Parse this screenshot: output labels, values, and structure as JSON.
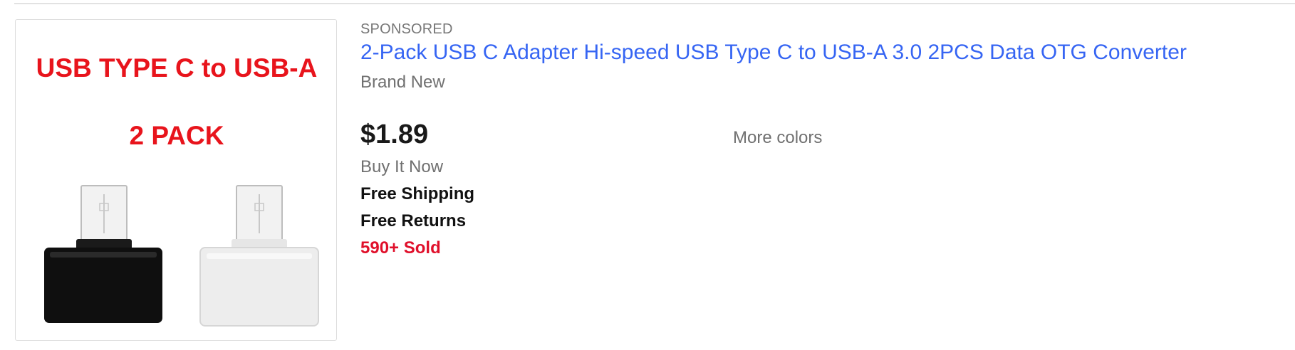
{
  "listing": {
    "badge": "SPONSORED",
    "title": "2-Pack USB C Adapter Hi-speed USB Type C to USB-A 3.0 2PCS Data OTG Converter",
    "condition": "Brand New",
    "price": "$1.89",
    "buy_format": "Buy It Now",
    "shipping": "Free Shipping",
    "returns": "Free Returns",
    "sold": "590+ Sold",
    "more_colors": "More colors",
    "image": {
      "line1": "USB TYPE C to USB-A",
      "line2": "2 PACK",
      "text_color": "#e8141c",
      "adapter_colors": [
        "#111111",
        "#efefef"
      ]
    }
  },
  "colors": {
    "link": "#3665f3",
    "sold": "#e0102b",
    "muted": "#707070",
    "price": "#191919"
  }
}
